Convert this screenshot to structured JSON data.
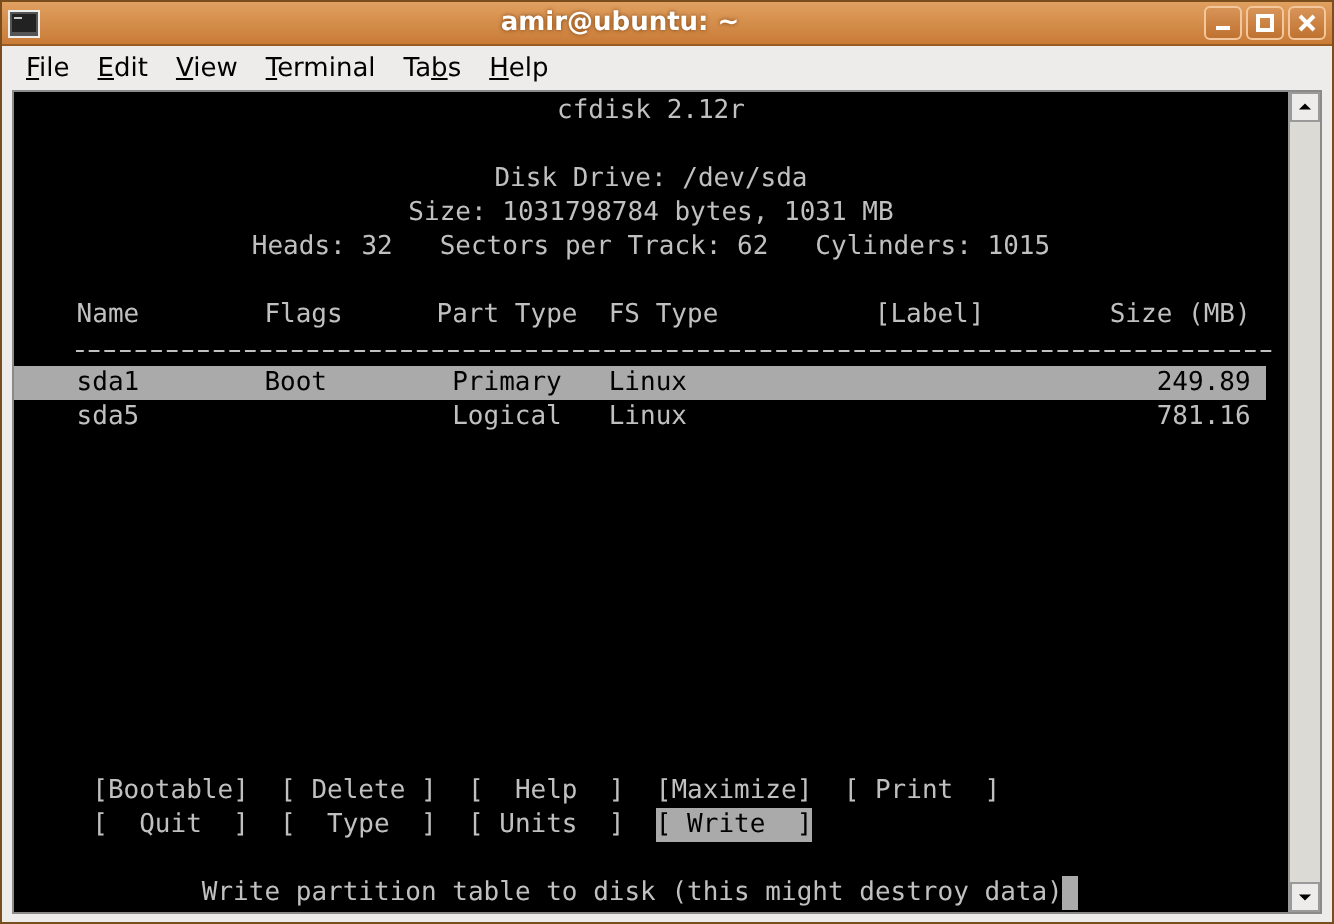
{
  "window": {
    "title": "amir@ubuntu: ~"
  },
  "menu": [
    {
      "mnemonic": "F",
      "rest": "ile"
    },
    {
      "mnemonic": "E",
      "rest": "dit"
    },
    {
      "mnemonic": "V",
      "rest": "iew"
    },
    {
      "mnemonic": "T",
      "rest": "erminal"
    },
    {
      "before": "Ta",
      "mnemonic": "b",
      "rest": "s"
    },
    {
      "mnemonic": "H",
      "rest": "elp"
    }
  ],
  "terminal": {
    "program": "cfdisk 2.12r",
    "drive": "Disk Drive: /dev/sda",
    "size": "Size: 1031798784 bytes, 1031 MB",
    "geometry": "Heads: 32   Sectors per Track: 62   Cylinders: 1015",
    "columns": [
      "Name",
      "Flags",
      "Part Type",
      "FS Type",
      "[Label]",
      "Size (MB)"
    ],
    "partitions": [
      {
        "name": "sda1",
        "flags": "Boot",
        "part_type": "Primary",
        "fs_type": "Linux",
        "size": "249.89",
        "selected": true
      },
      {
        "name": "sda5",
        "part_type": "Logical",
        "fs_type": "Linux",
        "size": "781.16",
        "selected": false
      }
    ],
    "commands": [
      [
        {
          "label": "[Bootable]",
          "selected": false
        },
        {
          "label": "[ Delete ]",
          "selected": false
        },
        {
          "label": "[  Help  ]",
          "selected": false
        },
        {
          "label": "[Maximize]",
          "selected": false
        },
        {
          "label": "[ Print  ]",
          "selected": false
        }
      ],
      [
        {
          "label": "[  Quit  ]",
          "selected": false
        },
        {
          "label": "[  Type  ]",
          "selected": false
        },
        {
          "label": "[ Units  ]",
          "selected": false
        },
        {
          "label": "[ Write  ]",
          "selected": true
        }
      ]
    ],
    "status": "Write partition table to disk (this might destroy data)"
  }
}
